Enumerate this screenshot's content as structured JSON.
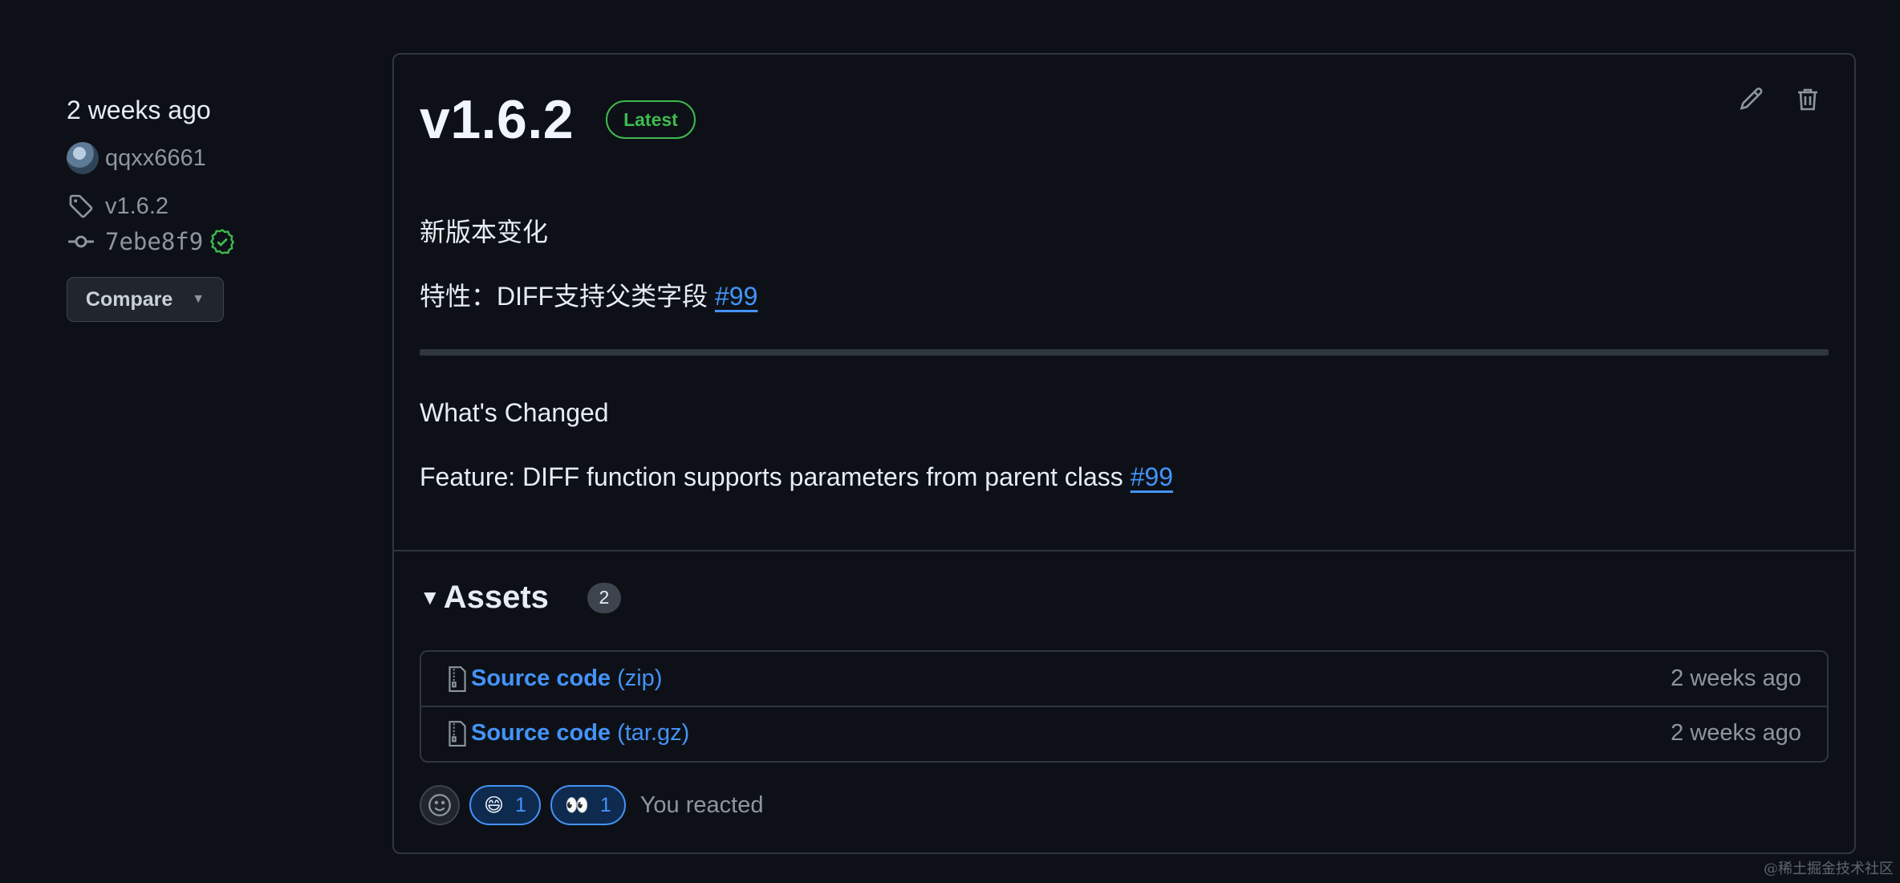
{
  "sidebar": {
    "time_ago": "2 weeks ago",
    "author": "qqxx6661",
    "tag": "v1.6.2",
    "commit": "7ebe8f9",
    "compare_label": "Compare"
  },
  "release": {
    "title": "v1.6.2",
    "badge": "Latest",
    "body": {
      "heading_cn": "新版本变化",
      "feature_cn_prefix": "特性：DIFF支持父类字段 ",
      "feature_cn_link": "#99",
      "whats_changed": "What's Changed",
      "feature_en_prefix": "Feature: DIFF function supports parameters from parent class ",
      "feature_en_link": "#99"
    }
  },
  "assets": {
    "title": "Assets",
    "count": "2",
    "items": [
      {
        "name": "Source code",
        "ext": "(zip)",
        "time": "2 weeks ago"
      },
      {
        "name": "Source code",
        "ext": "(tar.gz)",
        "time": "2 weeks ago"
      }
    ]
  },
  "reactions": {
    "items": [
      {
        "emoji": "😄",
        "count": "1"
      },
      {
        "emoji": "👀",
        "count": "1"
      }
    ],
    "status": "You reacted"
  },
  "watermark": "@稀土掘金技术社区",
  "colors": {
    "background": "#0d1117",
    "border": "#30363d",
    "link": "#4493f8",
    "success": "#3fb950",
    "muted": "#8d96a0"
  }
}
